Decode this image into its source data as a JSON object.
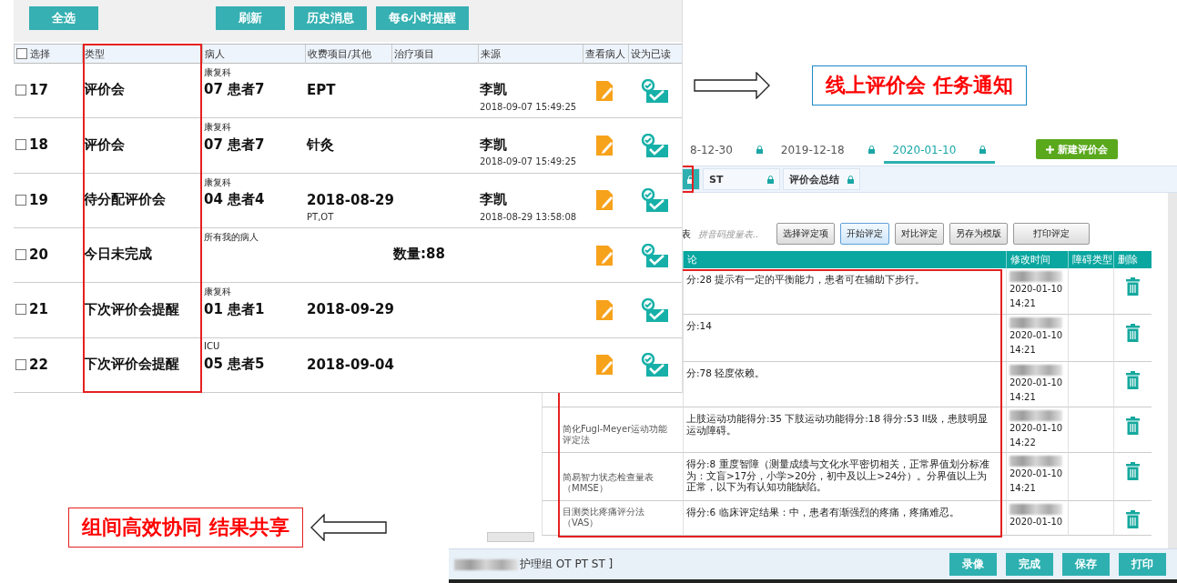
{
  "task_panel": {
    "toolbar": {
      "left": [
        {
          "label": "全选"
        }
      ],
      "right": [
        {
          "label": "刷新"
        },
        {
          "label": "历史消息"
        },
        {
          "label": "每6小时提醒"
        }
      ]
    },
    "select_all": {
      "label": "选择",
      "checked": false
    },
    "columns": [
      "类型",
      "病人",
      "收费项目/其他",
      "治疗项目",
      "来源",
      "查看病人",
      "设为已读"
    ],
    "rows": [
      {
        "number": "17",
        "checked": false,
        "type": "评价会",
        "department": "康复科",
        "patient": "07 患者7",
        "fee": "EPT",
        "source": "李凯",
        "source_time": "2018-09-07 15:49:25"
      },
      {
        "number": "18",
        "checked": false,
        "type": "评价会",
        "department": "康复科",
        "patient": "07 患者7",
        "fee": "针灸",
        "source": "李凯",
        "source_time": "2018-09-07 15:49:25"
      },
      {
        "number": "19",
        "checked": false,
        "type": "待分配评价会",
        "department": "康复科",
        "patient": "04 患者4",
        "fee": "2018-08-29",
        "fee_note": "PT,OT",
        "source": "李凯",
        "source_time": "2018-08-29 13:58:08"
      },
      {
        "number": "20",
        "checked": false,
        "type": "今日未完成",
        "department": "所有我的病人",
        "treatment": "数量:88"
      },
      {
        "number": "21",
        "checked": false,
        "type": "下次评价会提醒",
        "department": "康复科",
        "patient": "01 患者1",
        "fee": "2018-09-29"
      },
      {
        "number": "22",
        "checked": false,
        "type": "下次评价会提醒",
        "department": "ICU",
        "patient": "05 患者5",
        "fee": "2018-09-04"
      }
    ]
  },
  "evaluation_window": {
    "date_tabs": [
      {
        "label": "8-12-30",
        "selected": false
      },
      {
        "label": "2019-12-18",
        "selected": false
      },
      {
        "label": "2020-01-10",
        "selected": true
      }
    ],
    "new_button": "新建评价会",
    "subtabs": [
      {
        "selected": true
      },
      {
        "label": "ST",
        "selected": false
      },
      {
        "label": "评价会总结",
        "selected": false
      }
    ],
    "toolbar": {
      "label": "表",
      "search_placeholder": "拼音码搜量表..",
      "buttons": [
        {
          "label": "选择评定项",
          "selected": false
        },
        {
          "label": "开始评定",
          "selected": true
        },
        {
          "label": "对比评定",
          "selected": false
        },
        {
          "label": "另存为模版",
          "selected": false
        },
        {
          "label": "打印评定",
          "selected": false
        }
      ]
    },
    "table": {
      "columns": [
        "论",
        "修改时间",
        "障碍类型",
        "删除"
      ],
      "rows": [
        {
          "result": "分:28 提示有一定的平衡能力，患者可在辅助下步行。",
          "date": "2020-01-10",
          "time": "14:21"
        },
        {
          "result": "分:14",
          "date": "2020-01-10",
          "time": "14:21"
        },
        {
          "result": "分:78 轻度依赖。",
          "date": "2020-01-10",
          "time": "14:21"
        },
        {
          "scale": "简化Fugl-Meyer运动功能评定法",
          "result": "上肢运动功能得分:35 下肢运动功能得分:18 得分:53 II级，患肢明显运动障碍。",
          "date": "2020-01-10",
          "time": "14:22"
        },
        {
          "scale": "简易智力状态检查量表（MMSE）",
          "result": "得分:8 重度智障（测量成绩与文化水平密切相关，正常界值划分标准为：文盲>17分，小学>20分，初中及以上>24分）。分界值以上为正常，以下为有认知功能缺陷。",
          "date": "2020-01-10",
          "time": "14:21"
        },
        {
          "scale": "目测类比疼痛评分法（VAS）",
          "result": "得分:6 临床评定结果：中，患者有渐强烈的疼痛，疼痛难忍。",
          "date": "2020-01-10"
        }
      ]
    },
    "footer": {
      "group_text": "护理组 OT PT ST ]",
      "buttons": [
        {
          "label": "录像"
        },
        {
          "label": "完成"
        },
        {
          "label": "保存"
        },
        {
          "label": "打印"
        }
      ]
    }
  },
  "callouts": [
    {
      "text": "线上评价会 任务通知"
    },
    {
      "text": "组间高效协同 结果共享"
    }
  ]
}
